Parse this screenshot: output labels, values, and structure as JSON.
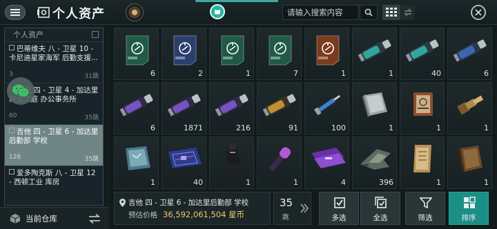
{
  "header": {
    "title": "个人资产",
    "search_placeholder": "请输入搜索内容"
  },
  "sidebar": {
    "section_title": "个人资产",
    "locations": [
      {
        "name": "巴蒂维夫 八 - 卫星 10 - 卡尼迪星家海军 后勤支援...",
        "count": "3",
        "jumps": "31跳"
      },
      {
        "name": "吉他 四 - 卫星 4 - 加达里商业法庭 办公事务所",
        "count": "60",
        "jumps": "35跳"
      },
      {
        "name": "吉他 四 - 卫星 6 - 加达里后勤部 学校",
        "count": "126",
        "jumps": "35跳"
      },
      {
        "name": "爱多陶克斯 八 - 卫星 12 - 西顿工业 库房",
        "count": "",
        "jumps": ""
      }
    ],
    "current_warehouse_label": "当前仓库"
  },
  "items": [
    {
      "icon": "green-blueprint-icon",
      "qty": "6"
    },
    {
      "icon": "blue-blueprint-icon",
      "qty": "2"
    },
    {
      "icon": "green-blueprint-icon",
      "qty": "1"
    },
    {
      "icon": "green-blueprint-icon",
      "qty": "7"
    },
    {
      "icon": "orange-blueprint-icon",
      "qty": "1"
    },
    {
      "icon": "teal-canister-icon",
      "qty": "1"
    },
    {
      "icon": "teal-canister-icon",
      "qty": "40"
    },
    {
      "icon": "blue-canister-icon",
      "qty": "6"
    },
    {
      "icon": "purple-canister-icon",
      "qty": "6"
    },
    {
      "icon": "purple-canister-icon",
      "qty": "1871"
    },
    {
      "icon": "purple-canister-icon",
      "qty": "216"
    },
    {
      "icon": "gold-canister-icon",
      "qty": "91"
    },
    {
      "icon": "syringe-icon",
      "qty": "100"
    },
    {
      "icon": "databook-icon",
      "qty": "1"
    },
    {
      "icon": "book-icon",
      "qty": "1"
    },
    {
      "icon": "telescope-icon",
      "qty": "1"
    },
    {
      "icon": "tablet-icon",
      "qty": "1"
    },
    {
      "icon": "circuit-board-icon",
      "qty": "40"
    },
    {
      "icon": "pilot-figure-icon",
      "qty": "1"
    },
    {
      "icon": "microphone-icon",
      "qty": "1"
    },
    {
      "icon": "purple-ticket-icon",
      "qty": "4"
    },
    {
      "icon": "ship-icon",
      "qty": "396"
    },
    {
      "icon": "scroll-icon",
      "qty": "1"
    },
    {
      "icon": "leather-book-icon",
      "qty": "1"
    }
  ],
  "info_bar": {
    "location": "吉他 四 - 卫星 6 - 加达里后勤部 学校",
    "price_label": "预估价格",
    "price_value": "36,592,061,504 星币",
    "jumps": "35",
    "jumps_unit": "跳"
  },
  "actions": {
    "multi_select": "多选",
    "select_all": "全选",
    "filter": "筛选",
    "sort": "排序"
  },
  "colors": {
    "accent": "#1b8e86",
    "price": "#f0c96a",
    "active_location": "#6f8586"
  }
}
